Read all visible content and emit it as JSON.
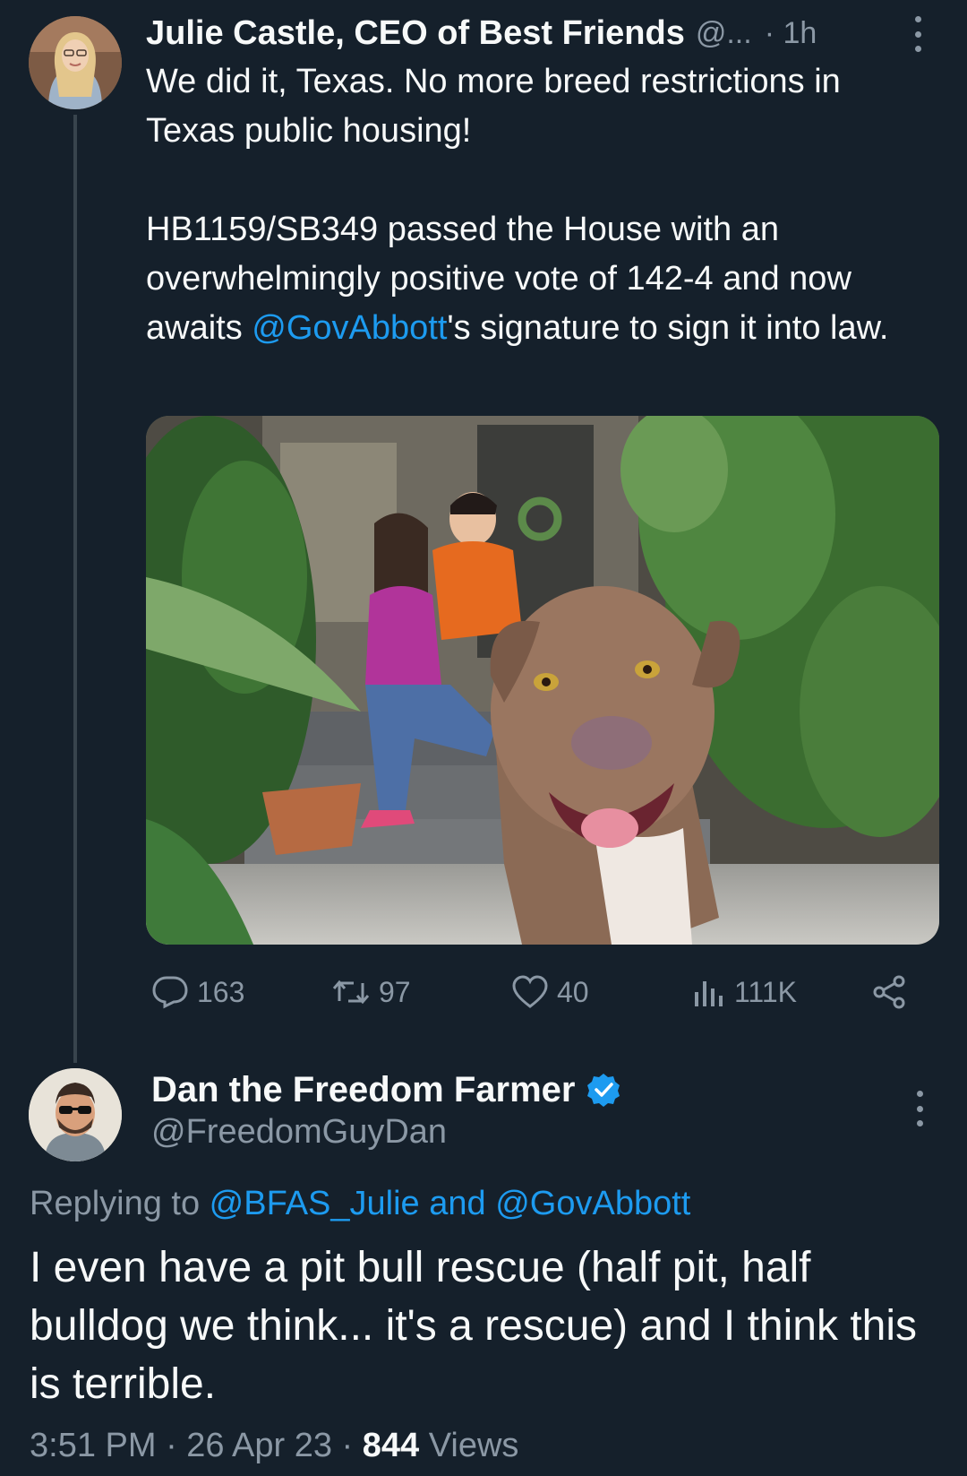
{
  "tweet": {
    "author_name": "Julie Castle, CEO of Best Friends",
    "author_handle": "@...",
    "time": "· 1h",
    "text_line1": "We did it, Texas. No more breed restrictions in Texas public housing!",
    "text_line2": "HB1159/SB349 passed the House with an overwhelmingly positive vote of 142-4 and now awaits ",
    "mention": "@GovAbbott",
    "text_line2_end": "'s signature to sign it into law.",
    "actions": {
      "replies": "163",
      "retweets": "97",
      "likes": "40",
      "views": "111K"
    }
  },
  "reply": {
    "author_name": "Dan the Freedom Farmer",
    "author_handle": "@FreedomGuyDan",
    "replying_prefix": "Replying to ",
    "replying_targets": "@BFAS_Julie and @GovAbbott",
    "text": "I even have a pit bull rescue (half pit, half bulldog we think... it's a rescue) and I think this is terrible.",
    "timestamp": "3:51 PM · 26 Apr 23 · ",
    "views_count": "844",
    "views_label": " Views"
  },
  "colors": {
    "background": "#15202b",
    "accent": "#1d9bf0",
    "secondary_text": "#8b98a5",
    "verified_badge": "#1d9bf0"
  },
  "icons": {
    "reply": "reply-bubble-icon",
    "retweet": "retweet-icon",
    "like": "heart-icon",
    "views": "views-bar-chart-icon",
    "share": "share-icon",
    "more": "more-vertical-icon",
    "verified": "verified-badge-icon"
  }
}
